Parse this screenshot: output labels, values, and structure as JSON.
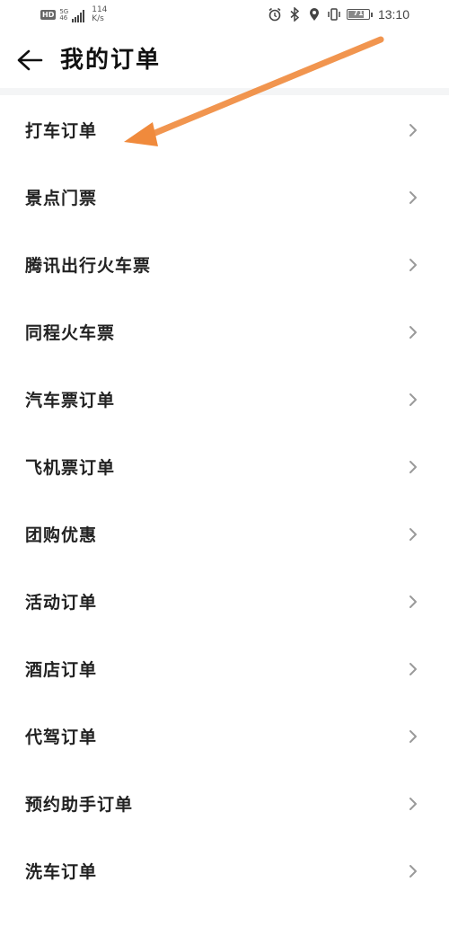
{
  "status_bar": {
    "hd": "HD",
    "net_top": "5G",
    "net_bottom": "46",
    "speed_value": "114",
    "speed_unit": "K/s",
    "battery_level": "71",
    "time": "13:10"
  },
  "header": {
    "title": "我的订单"
  },
  "orders": [
    {
      "label": "打车订单"
    },
    {
      "label": "景点门票"
    },
    {
      "label": "腾讯出行火车票"
    },
    {
      "label": "同程火车票"
    },
    {
      "label": "汽车票订单"
    },
    {
      "label": "飞机票订单"
    },
    {
      "label": "团购优惠"
    },
    {
      "label": "活动订单"
    },
    {
      "label": "酒店订单"
    },
    {
      "label": "代驾订单"
    },
    {
      "label": "预约助手订单"
    },
    {
      "label": "洗车订单"
    }
  ],
  "colors": {
    "annotation_arrow": "#f08a3c",
    "chevron": "#9a9a9a",
    "divider": "#f4f5f6"
  },
  "icons": {
    "back": "arrow-left-icon",
    "item_chevron": "chevron-right-icon",
    "alarm": "alarm-icon",
    "bluetooth": "bluetooth-icon",
    "location": "location-icon",
    "vibrate": "vibrate-icon",
    "battery": "battery-icon"
  }
}
